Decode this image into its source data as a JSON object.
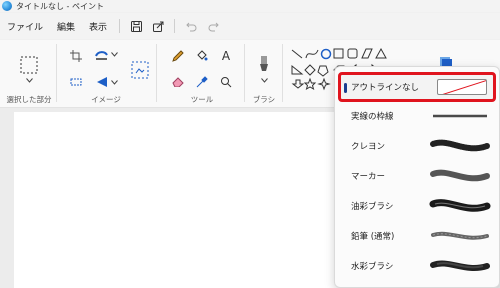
{
  "window": {
    "title": "タイトルなし - ペイント"
  },
  "menu": {
    "file": "ファイル",
    "edit": "編集",
    "view": "表示"
  },
  "ribbon": {
    "selection_label": "選択した部分",
    "image_label": "イメージ",
    "tools_label": "ツール",
    "brush_label": "ブラシ"
  },
  "outline_menu": {
    "items": [
      {
        "label": "アウトラインなし"
      },
      {
        "label": "実線の枠線"
      },
      {
        "label": "クレヨン"
      },
      {
        "label": "マーカー"
      },
      {
        "label": "油彩ブラシ"
      },
      {
        "label": "鉛筆 (通常)"
      },
      {
        "label": "水彩ブラシ"
      }
    ]
  },
  "colors": {
    "highlight": "#e0141e",
    "accent": "#2b6fd6",
    "active_color": "#000000"
  }
}
